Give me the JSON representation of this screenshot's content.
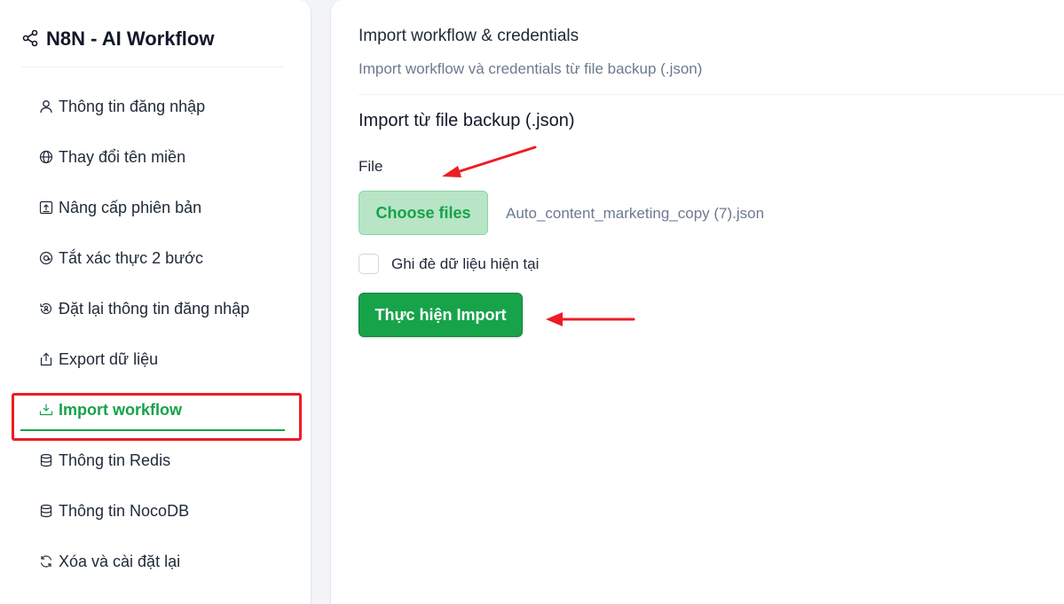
{
  "sidebar": {
    "brand": {
      "title": "N8N - AI Workflow",
      "icon": "share-icon"
    },
    "items": [
      {
        "label": "Thông tin đăng nhập",
        "icon": "user-icon"
      },
      {
        "label": "Thay đổi tên miền",
        "icon": "globe-icon"
      },
      {
        "label": "Nâng cấp phiên bản",
        "icon": "upgrade-icon"
      },
      {
        "label": "Tắt xác thực 2 bước",
        "icon": "at-icon"
      },
      {
        "label": "Đặt lại thông tin đăng nhập",
        "icon": "reset-icon"
      },
      {
        "label": "Export dữ liệu",
        "icon": "export-icon"
      },
      {
        "label": "Import workflow",
        "icon": "import-icon",
        "active": true
      },
      {
        "label": "Thông tin Redis",
        "icon": "database-icon"
      },
      {
        "label": "Thông tin NocoDB",
        "icon": "database-icon"
      },
      {
        "label": "Xóa và cài đặt lại",
        "icon": "refresh-icon"
      }
    ]
  },
  "main": {
    "title": "Import workflow & credentials",
    "subtitle": "Import workflow và credentials từ file backup (.json)",
    "section_title": "Import từ file backup (.json)",
    "file_label": "File",
    "choose_files_label": "Choose files",
    "selected_file": "Auto_content_marketing_copy (7).json",
    "overwrite_label": "Ghi đè dữ liệu hiện tại",
    "overwrite_checked": false,
    "import_button_label": "Thực hiện Import"
  },
  "colors": {
    "accent": "#16a34a",
    "accent_light": "#b7e5c6",
    "annotation_red": "#ee1c25",
    "muted_text": "#6b7a90"
  }
}
